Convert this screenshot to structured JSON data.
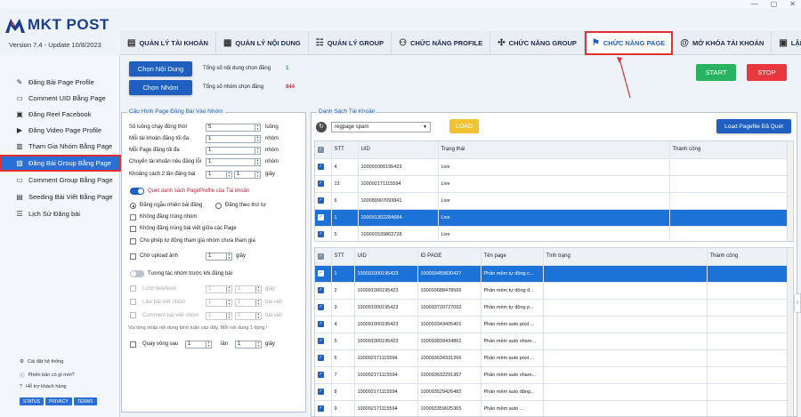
{
  "app": {
    "name": "MKT POST",
    "version": "Version  7.4  -  Update  10/8/2023"
  },
  "window_controls": {
    "minimize": "—",
    "maximize": "▢",
    "close": "✕"
  },
  "tabs": [
    {
      "label": "QUẢN LÝ TÀI KHOẢN",
      "icon": "id-card-icon"
    },
    {
      "label": "QUẢN LÝ NỘI DUNG",
      "icon": "grid-icon"
    },
    {
      "label": "QUẢN LÝ GROUP",
      "icon": "group-icon"
    },
    {
      "label": "CHỨC NĂNG PROFILE",
      "icon": "profile-icon"
    },
    {
      "label": "CHỨC NĂNG GROUP",
      "icon": "puzzle-icon"
    },
    {
      "label": "CHỨC NĂNG PAGE",
      "icon": "flag-icon",
      "active": true
    },
    {
      "label": "MỞ KHÓA TÀI KHOẢN",
      "icon": "at-icon"
    },
    {
      "label": "LẬP LỊCH",
      "icon": "calendar-icon"
    }
  ],
  "sidebar": {
    "items": [
      {
        "label": "Đăng Bài Page Profile"
      },
      {
        "label": "Comment UID Bằng Page"
      },
      {
        "label": "Đăng Reel Facebook"
      },
      {
        "label": "Đăng Video Page Profile"
      },
      {
        "label": "Tham Gia Nhóm Bằng Page"
      },
      {
        "label": "Đăng Bài Group Bằng Page",
        "active": true
      },
      {
        "label": "Comment Group Bằng Page"
      },
      {
        "label": "Seeding Bài Viết Bằng Page"
      },
      {
        "label": "Lịch Sử Đăng bài"
      }
    ],
    "footer": [
      {
        "label": "Cài đặt hệ thống"
      },
      {
        "label": "Phiên bản có gì mới?"
      },
      {
        "label": "Hỗ trợ khách hàng"
      }
    ],
    "badges": [
      "STATUS",
      "PRIVACY",
      "TERMS"
    ]
  },
  "top": {
    "chon_noi_dung": "Chọn Nội Dung",
    "noi_dung_label": "Tổng số nội dung chọn đăng",
    "noi_dung_count": "1",
    "chon_nhom": "Chọn Nhóm",
    "nhom_label": "Tổng số nhóm chọn đăng",
    "nhom_count": "844",
    "start": "START",
    "stop": "STOP"
  },
  "config": {
    "title": "Cấu Hình Page Đăng Bài Vào Nhóm",
    "rows": [
      {
        "label": "Số luồng chạy đồng thời",
        "value": "5",
        "unit": "luồng"
      },
      {
        "label": "Mỗi tài khoản đăng tối đa",
        "value": "1",
        "unit": "nhóm"
      },
      {
        "label": "Mỗi Page đăng tối đa",
        "value": "1",
        "unit": "nhóm"
      },
      {
        "label": "Chuyển tài khoản nếu đăng lỗi",
        "value": "1",
        "unit": "nhóm"
      },
      {
        "label": "Khoảng cách 2 lần đăng bài",
        "value": "1",
        "value2": "1",
        "unit": "giây"
      }
    ],
    "toggle1": "Quét danh sách PageProfile của Tài khoản",
    "radio1": "Đăng ngẫu nhiên bài đăng",
    "radio2": "Đăng theo thứ tự",
    "checks": [
      "Không đăng trùng nhóm",
      "Không đăng trùng bài viết giữa các Page",
      "Cho phép tự động tham gia nhóm chưa tham gia"
    ],
    "upload_label": "Chờ upload ảnh",
    "upload_value": "1",
    "upload_unit": "giây",
    "toggle2": "Tương tác nhóm trước khi đăng bài",
    "interact": [
      {
        "label": "Lướt newfeed",
        "v1": "1",
        "v2": "1",
        "unit": "giây"
      },
      {
        "label": "Like bài viết nhóm",
        "v1": "1",
        "v2": "1",
        "unit": "bài viết"
      },
      {
        "label": "Comment bài viết nhóm",
        "v1": "1",
        "v2": "1",
        "unit": "bài viết"
      }
    ],
    "note": "Vui lòng nhập nội dung bình luận vào đây, Mỗi nội dung 1 dòng !",
    "repeat_label": "Quay vòng sau",
    "repeat_v1": "1",
    "repeat_mid": "lần",
    "repeat_v2": "1",
    "repeat_unit": "giây"
  },
  "accounts": {
    "title": "Danh Sách Tài Khoản",
    "dropdown": "regpage spam",
    "load": "LOAD",
    "load_pagefile": "Load Pagefile Đã Quét",
    "headers": [
      "STT",
      "UID",
      "Trạng thái",
      "Thành công"
    ],
    "rows": [
      {
        "stt": "4",
        "uid": "100091000195423",
        "status": "Live"
      },
      {
        "stt": "13",
        "uid": "100092171115594",
        "status": "Live"
      },
      {
        "stt": "6",
        "uid": "100089907093841",
        "status": "Live"
      },
      {
        "stt": "1",
        "uid": "100091302284684",
        "status": "Live",
        "sel": true
      },
      {
        "stt": "5",
        "uid": "100091539863728",
        "status": "Live"
      }
    ]
  },
  "pages": {
    "headers": [
      "STT",
      "UID",
      "ID PAGE",
      "Tên page",
      "Tình trạng",
      "Thành công"
    ],
    "rows": [
      {
        "stt": "1",
        "uid": "100091000195423",
        "id": "100093459830427",
        "name": "Phần mềm tự động c...",
        "sel": true
      },
      {
        "stt": "2",
        "uid": "100091000195423",
        "id": "100093688478566",
        "name": "Phần mềm tự động đ..."
      },
      {
        "stt": "3",
        "uid": "100091000195423",
        "id": "100093720727092",
        "name": "Phần mềm tự động p..."
      },
      {
        "stt": "4",
        "uid": "100091000195423",
        "id": "100093343405401",
        "name": "Phần mềm auto post ..."
      },
      {
        "stt": "5",
        "uid": "100091000195423",
        "id": "100093839434861",
        "name": "Phần mềm auto share..."
      },
      {
        "stt": "6",
        "uid": "100092171115594",
        "id": "100093634331266",
        "name": "Phần mềm auto post ..."
      },
      {
        "stt": "7",
        "uid": "100092171115594",
        "id": "100093632291367",
        "name": "Phần mềm auto share..."
      },
      {
        "stt": "8",
        "uid": "100092171115594",
        "id": "100093529426482",
        "name": "Phần mềm auto đăng..."
      },
      {
        "stt": "9",
        "uid": "100092171115594",
        "id": "100093359025365",
        "name": "Phần mềm auto ..."
      }
    ]
  }
}
